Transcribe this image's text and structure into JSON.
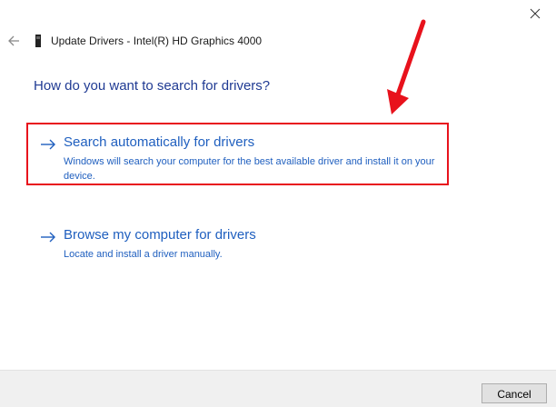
{
  "window": {
    "title": "Update Drivers - Intel(R) HD Graphics 4000",
    "icons": {
      "back": "back-arrow-icon",
      "device": "device-icon",
      "close": "close-icon"
    }
  },
  "question": "How do you want to search for drivers?",
  "options": [
    {
      "title": "Search automatically for drivers",
      "description": "Windows will search your computer for the best available driver and install it on your device.",
      "icon": "arrow-right-icon",
      "highlighted": true
    },
    {
      "title": "Browse my computer for drivers",
      "description": "Locate and install a driver manually.",
      "icon": "arrow-right-icon",
      "highlighted": false
    }
  ],
  "footer": {
    "cancel_label": "Cancel"
  },
  "colors": {
    "link": "#1f5fbf",
    "heading": "#1f3a93",
    "annotation": "#e8121c",
    "footer_bg": "#f0f0f0"
  }
}
